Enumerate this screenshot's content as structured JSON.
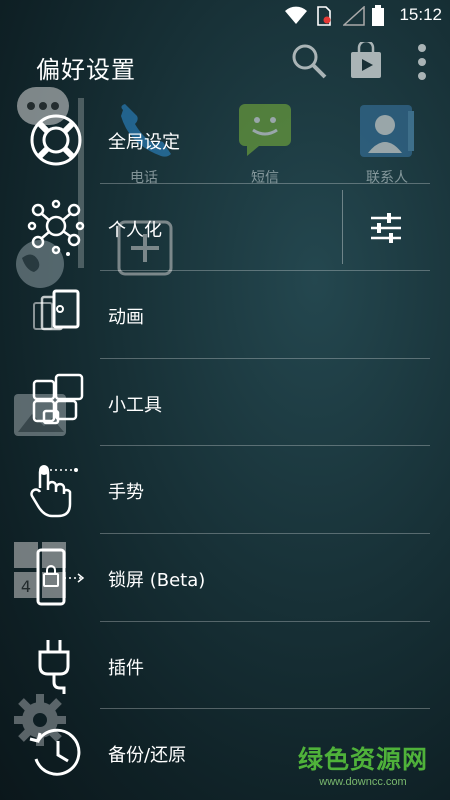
{
  "status_bar": {
    "time": "15:12"
  },
  "header": {
    "title": "偏好设置"
  },
  "background": {
    "apps": [
      "电话",
      "短信",
      "联系人"
    ]
  },
  "menu": {
    "items": [
      {
        "label": "全局设定",
        "icon": "lifebuoy-icon"
      },
      {
        "label": "个人化",
        "icon": "molecule-icon"
      },
      {
        "label": "动画",
        "icon": "cards-icon"
      },
      {
        "label": "小工具",
        "icon": "widgets-icon"
      },
      {
        "label": "手势",
        "icon": "hand-pointer-icon"
      },
      {
        "label": "锁屏 (Beta)",
        "icon": "phone-lock-icon"
      },
      {
        "label": "插件",
        "icon": "plug-icon"
      },
      {
        "label": "备份/还原",
        "icon": "clock-history-icon"
      }
    ]
  },
  "watermark": {
    "brand": "绿色资源网",
    "url": "www.downcc.com"
  },
  "colors": {
    "accent_green": "#4fb23a",
    "bg_dark": "#0f2126"
  }
}
